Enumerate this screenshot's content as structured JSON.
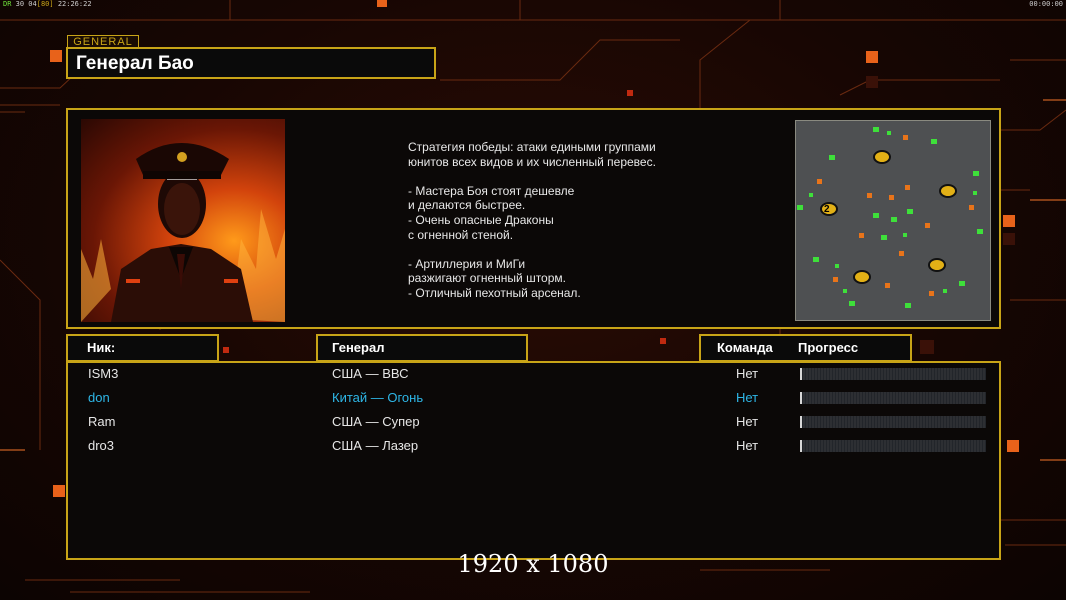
{
  "hud": {
    "left_prefix": "DR",
    "left_nums": "30 04",
    "left_bracket": "[80]",
    "left_time": "22:26:22",
    "right_time": "00:00:00"
  },
  "general": {
    "tab_label": "GENERAL",
    "name": "Генерал Бао",
    "description": "Стратегия победы: атаки едиными группами\nюнитов всех видов и их численный перевес.\n\n- Мастера Боя стоят дешевле\nи делаются быстрее.\n- Очень опасные Драконы\nс огненной стеной.\n\n- Артиллерия и МиГи\nразжигают огненный шторм.\n- Отличный пехотный арсенал."
  },
  "minimap": {
    "player_marker": "2"
  },
  "table": {
    "headers": {
      "nick": "Ник:",
      "general": "Генерал",
      "team": "Команда",
      "progress": "Прогресс"
    },
    "rows": [
      {
        "nick": "ISM3",
        "general": "США — ВВС",
        "team": "Нет",
        "progress": 0.01,
        "highlight": false
      },
      {
        "nick": "don",
        "general": "Китай — Огонь",
        "team": "Нет",
        "progress": 0.01,
        "highlight": true
      },
      {
        "nick": "Ram",
        "general": "США — Супер",
        "team": "Нет",
        "progress": 0.01,
        "highlight": false
      },
      {
        "nick": "dro3",
        "general": "США — Лазер",
        "team": "Нет",
        "progress": 0.01,
        "highlight": false
      }
    ]
  },
  "resolution_label": "1920 x 1080",
  "colors": {
    "accent_gold": "#c8a417",
    "highlight_blue": "#2eb6e6",
    "background": "#140603"
  }
}
